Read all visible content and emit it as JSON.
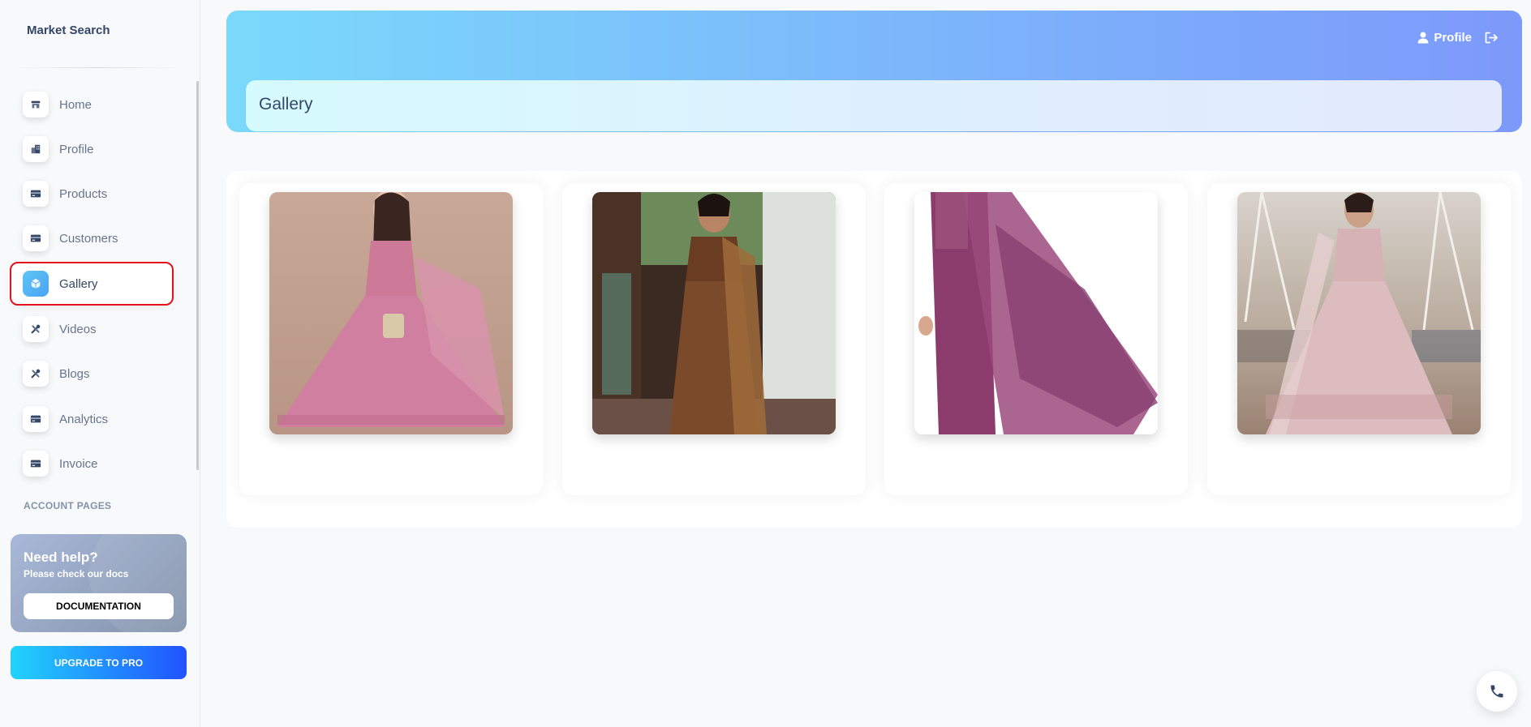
{
  "sidebar": {
    "brand": "Market Search",
    "items": [
      {
        "label": "Home",
        "icon": "shop-icon"
      },
      {
        "label": "Profile",
        "icon": "office-icon"
      },
      {
        "label": "Products",
        "icon": "credit-card-icon"
      },
      {
        "label": "Customers",
        "icon": "credit-card-icon"
      },
      {
        "label": "Gallery",
        "icon": "box-3d-icon",
        "active": true
      },
      {
        "label": "Videos",
        "icon": "tools-icon"
      },
      {
        "label": "Blogs",
        "icon": "tools-icon"
      },
      {
        "label": "Analytics",
        "icon": "credit-card-icon"
      },
      {
        "label": "Invoice",
        "icon": "credit-card-icon"
      }
    ],
    "section_title": "ACCOUNT PAGES",
    "help": {
      "title": "Need help?",
      "subtitle": "Please check our docs",
      "button": "DOCUMENTATION"
    },
    "upgrade_button": "UPGRADE TO PRO"
  },
  "header": {
    "profile_label": "Profile",
    "page_title": "Gallery"
  },
  "gallery": {
    "images": [
      {
        "alt": "pink anarkali gown",
        "icon": "photo-icon"
      },
      {
        "alt": "bronze saree",
        "icon": "photo-icon"
      },
      {
        "alt": "purple kurta with dupatta",
        "icon": "photo-icon"
      },
      {
        "alt": "blush lehenga",
        "icon": "photo-icon"
      }
    ]
  },
  "colors": {
    "accent": "#7ad9fb",
    "active_outline": "#e3121b",
    "text": "#344767",
    "muted": "#67748e"
  }
}
